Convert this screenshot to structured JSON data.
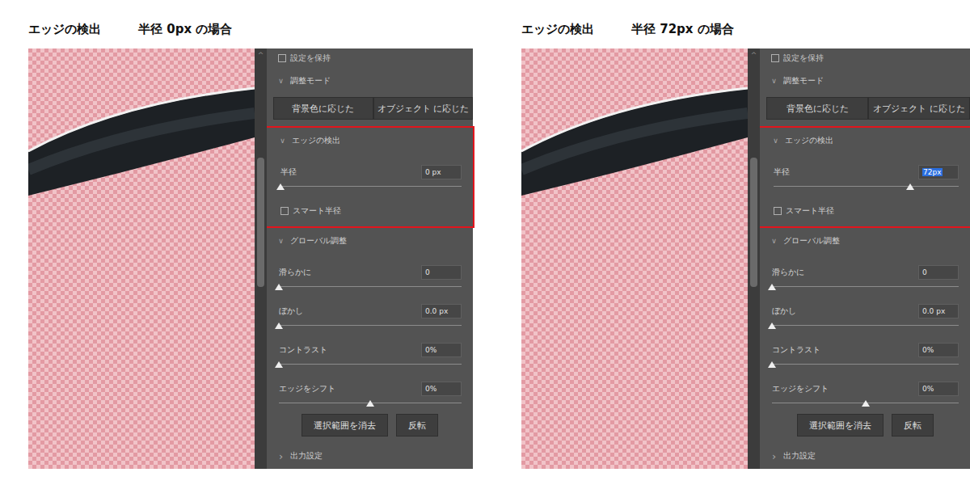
{
  "panels": [
    {
      "heading": {
        "title": "エッジの検出",
        "subtitle": "半径 0px の場合"
      },
      "scrollbar": {
        "arrow": "^",
        "level": 0.35
      },
      "keep_settings": {
        "label": "設定を保持",
        "checked": false
      },
      "sections": [
        {
          "title": "調整モード",
          "chevron": "∨",
          "expanded": true,
          "highlighted": false,
          "rows": [
            {
              "kind": "segmented",
              "options": [
                {
                  "label": "背景色に応じた",
                  "selected": false
                },
                {
                  "label": "オブジェクト に応じた",
                  "selected": false
                }
              ]
            }
          ]
        },
        {
          "title": "エッジの検出",
          "chevron": "∨",
          "expanded": true,
          "highlighted": true,
          "rows": [
            {
              "kind": "slider",
              "label": "半径",
              "value": "0 px",
              "level": 0,
              "value_selected": false
            },
            {
              "kind": "checkbox",
              "label": "スマート半径",
              "checked": false
            }
          ]
        },
        {
          "title": "グローバル調整",
          "chevron": "∨",
          "expanded": true,
          "highlighted": false,
          "rows": [
            {
              "kind": "slider",
              "label": "滑らかに",
              "value": "0",
              "level": 0,
              "value_selected": false
            },
            {
              "kind": "slider",
              "label": "ぼかし",
              "value": "0.0 px",
              "level": 0,
              "value_selected": false
            },
            {
              "kind": "slider",
              "label": "コントラスト",
              "value": "0%",
              "level": 0,
              "value_selected": false
            },
            {
              "kind": "slider",
              "label": "エッジをシフト",
              "value": "0%",
              "level": 0.5,
              "value_selected": false
            },
            {
              "kind": "buttons",
              "buttons": [
                "選択範囲を消去",
                "反転"
              ]
            }
          ]
        },
        {
          "title": "出力設定",
          "chevron": "›",
          "expanded": false,
          "highlighted": false,
          "rows": []
        }
      ]
    },
    {
      "heading": {
        "title": "エッジの検出",
        "subtitle": "半径 72px の場合"
      },
      "scrollbar": {
        "arrow": "^",
        "level": 0.35
      },
      "keep_settings": {
        "label": "設定を保持",
        "checked": false
      },
      "sections": [
        {
          "title": "調整モード",
          "chevron": "∨",
          "expanded": true,
          "highlighted": false,
          "rows": [
            {
              "kind": "segmented",
              "options": [
                {
                  "label": "背景色に応じた",
                  "selected": false
                },
                {
                  "label": "オブジェクト に応じた",
                  "selected": false
                }
              ]
            }
          ]
        },
        {
          "title": "エッジの検出",
          "chevron": "∨",
          "expanded": true,
          "highlighted": true,
          "rows": [
            {
              "kind": "slider",
              "label": "半径",
              "value": "72px",
              "level": 0.74,
              "value_selected": true
            },
            {
              "kind": "checkbox",
              "label": "スマート半径",
              "checked": false
            }
          ]
        },
        {
          "title": "グローバル調整",
          "chevron": "∨",
          "expanded": true,
          "highlighted": false,
          "rows": [
            {
              "kind": "slider",
              "label": "滑らかに",
              "value": "0",
              "level": 0,
              "value_selected": false
            },
            {
              "kind": "slider",
              "label": "ぼかし",
              "value": "0.0 px",
              "level": 0,
              "value_selected": false
            },
            {
              "kind": "slider",
              "label": "コントラスト",
              "value": "0%",
              "level": 0,
              "value_selected": false
            },
            {
              "kind": "slider",
              "label": "エッジをシフト",
              "value": "0%",
              "level": 0.5,
              "value_selected": false
            },
            {
              "kind": "buttons",
              "buttons": [
                "選択範囲を消去",
                "反転"
              ]
            }
          ]
        },
        {
          "title": "出力設定",
          "chevron": "›",
          "expanded": false,
          "highlighted": false,
          "rows": []
        }
      ]
    }
  ]
}
